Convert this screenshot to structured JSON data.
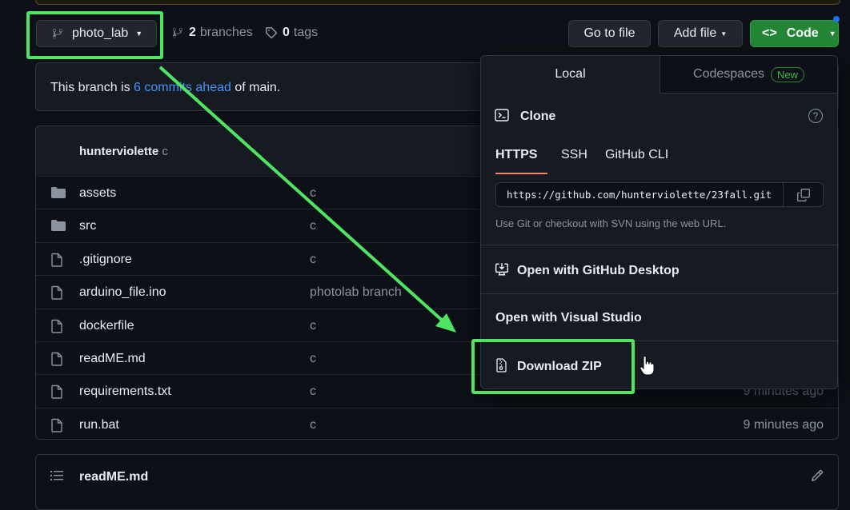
{
  "toolbar": {
    "branch_name": "photo_lab",
    "branches_count": "2",
    "branches_label": "branches",
    "tags_count": "0",
    "tags_label": "tags",
    "go_to_file": "Go to file",
    "add_file": "Add file",
    "code": "Code"
  },
  "banner": {
    "prefix": "This branch is ",
    "link": "6 commits ahead",
    "suffix": " of main."
  },
  "commit": {
    "author": "hunterviolette",
    "message": "c"
  },
  "files": [
    {
      "name": "assets",
      "type": "folder",
      "message": "c",
      "time": ""
    },
    {
      "name": "src",
      "type": "folder",
      "message": "c",
      "time": ""
    },
    {
      "name": ".gitignore",
      "type": "file",
      "message": "c",
      "time": ""
    },
    {
      "name": "arduino_file.ino",
      "type": "file",
      "message": "photolab branch",
      "time": ""
    },
    {
      "name": "dockerfile",
      "type": "file",
      "message": "c",
      "time": ""
    },
    {
      "name": "readME.md",
      "type": "file",
      "message": "c",
      "time": ""
    },
    {
      "name": "requirements.txt",
      "type": "file",
      "message": "c",
      "time": "9 minutes ago"
    },
    {
      "name": "run.bat",
      "type": "file",
      "message": "c",
      "time": "9 minutes ago"
    }
  ],
  "readme": {
    "title": "readME.md"
  },
  "dropdown": {
    "tab_local": "Local",
    "tab_codespaces": "Codespaces",
    "new_badge": "New",
    "clone_title": "Clone",
    "subtabs": [
      "HTTPS",
      "SSH",
      "GitHub CLI"
    ],
    "clone_url": "https://github.com/hunterviolette/23fall.git",
    "hint": "Use Git or checkout with SVN using the web URL.",
    "open_desktop": "Open with GitHub Desktop",
    "open_vs": "Open with Visual Studio",
    "download_zip": "Download ZIP"
  },
  "colors": {
    "accent_green": "#238636",
    "highlight": "#4ee563",
    "link_blue": "#4493f8",
    "background": "#0d1117"
  }
}
